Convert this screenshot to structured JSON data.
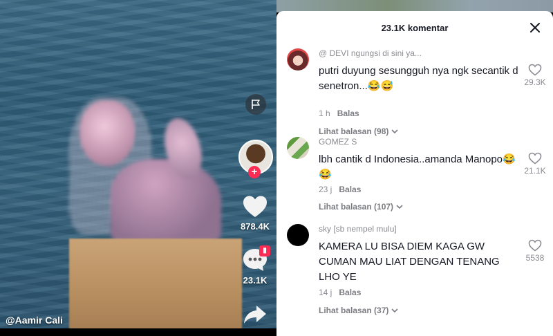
{
  "video": {
    "username": "@Aamir Cali",
    "like_count": "878.4K",
    "comment_count": "23.1K"
  },
  "comments_panel": {
    "title": "23.1K komentar",
    "comments": [
      {
        "author": "@ DEVI ngungsi di sini ya...",
        "text": "putri duyung sesungguh nya ngk secantik d senetron...😂😅",
        "time": "1 h",
        "reply_label": "Balas",
        "replies_label": "Lihat balasan (98)",
        "likes": "29.3K"
      },
      {
        "author": "GOMEZ S",
        "text": "lbh cantik d Indonesia..amanda Manopo😂😂",
        "time": "23 j",
        "reply_label": "Balas",
        "replies_label": "Lihat balasan (107)",
        "likes": "21.1K"
      },
      {
        "author": "sky [sb nempel mulu]",
        "text": "KAMERA LU BISA DIEM KAGA GW CUMAN MAU LIAT DENGAN TENANG LHO YE",
        "time": "14 j",
        "reply_label": "Balas",
        "replies_label": "Lihat balasan (37)",
        "likes": "5538"
      }
    ]
  },
  "colors": {
    "accent": "#fe2c55",
    "text_primary": "#161823",
    "text_secondary": "#8a8b91"
  },
  "icons": [
    "flag-icon",
    "heart-icon",
    "comment-icon",
    "share-icon",
    "close-icon",
    "chevron-down-icon",
    "gift-icon",
    "plus-icon"
  ]
}
